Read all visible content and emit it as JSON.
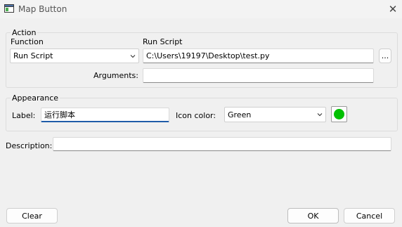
{
  "window": {
    "title": "Map Button"
  },
  "action": {
    "legend": "Action",
    "function_label": "Function",
    "function_value": "Run Script",
    "script_label": "Run Script",
    "script_path": "C:\\Users\\19197\\Desktop\\test.py",
    "browse_label": "...",
    "arguments_label": "Arguments:",
    "arguments_value": ""
  },
  "appearance": {
    "legend": "Appearance",
    "label_label": "Label:",
    "label_value": "运行脚本",
    "icon_color_label": "Icon color:",
    "icon_color_value": "Green",
    "swatch_color": "#00c000"
  },
  "description": {
    "label": "Description:",
    "value": ""
  },
  "buttons": {
    "clear": "Clear",
    "ok": "OK",
    "cancel": "Cancel"
  }
}
